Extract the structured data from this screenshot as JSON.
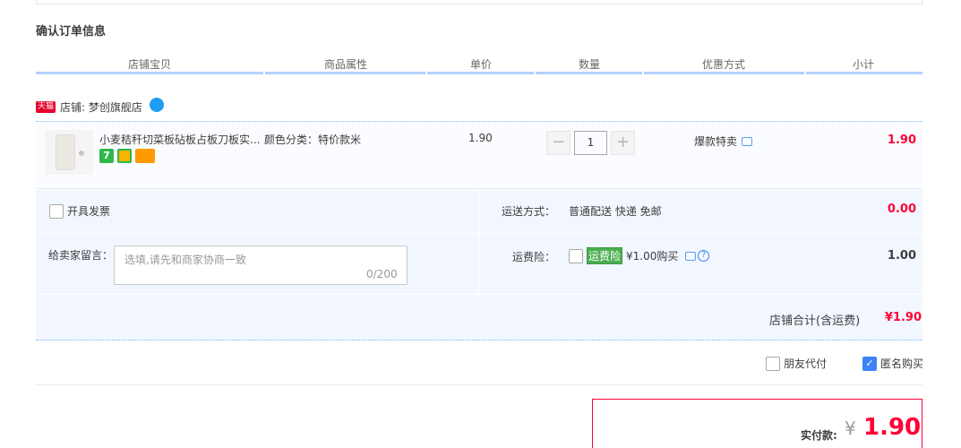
{
  "section": {
    "title": "确认订单信息"
  },
  "columns": [
    "店铺宝贝",
    "商品属性",
    "单价",
    "数量",
    "优惠方式",
    "小计"
  ],
  "shop": {
    "badge": "天猫",
    "label": "店铺: 梦创旗舰店"
  },
  "item": {
    "title": "小麦秸秆切菜板砧板占板刀板实...",
    "attr": "颜色分类：特价款米",
    "price": "1.90",
    "qty": "1",
    "qty_minus": "−",
    "qty_plus": "+",
    "promo": "爆款特卖",
    "subtotal": "1.90",
    "svc_icon_1": "7"
  },
  "options": {
    "invoice_label": "开具发票",
    "message_label": "给卖家留言：",
    "message_placeholder": "选填,请先和商家协商一致",
    "message_count": "0/200",
    "shipping_label": "运送方式：",
    "shipping_value": "普通配送 快递 免邮",
    "shipping_fee": "0.00",
    "insurance_label": "运费险：",
    "insurance_tag": "运费险",
    "insurance_text": "¥1.00购买",
    "insurance_fee": "1.00",
    "qmark": "?"
  },
  "shop_total": {
    "label": "店铺合计(含运费)",
    "value": "¥1.90"
  },
  "extras": {
    "friend_pay": "朋友代付",
    "anonymous": "匿名购买",
    "check": "✓"
  },
  "payment": {
    "label": "实付款:",
    "currency": "¥",
    "amount": "1.90"
  },
  "colors": {
    "accent": "#ff0036",
    "header_line": "#b2d1ff",
    "panel_bg": "#f2f7ff",
    "checkbox_on": "#3d82f7"
  },
  "icons": [
    "tmall-badge",
    "wangwang-chat-icon",
    "chat-bubble-icon",
    "question-icon",
    "checkbox",
    "checkmark-icon"
  ]
}
